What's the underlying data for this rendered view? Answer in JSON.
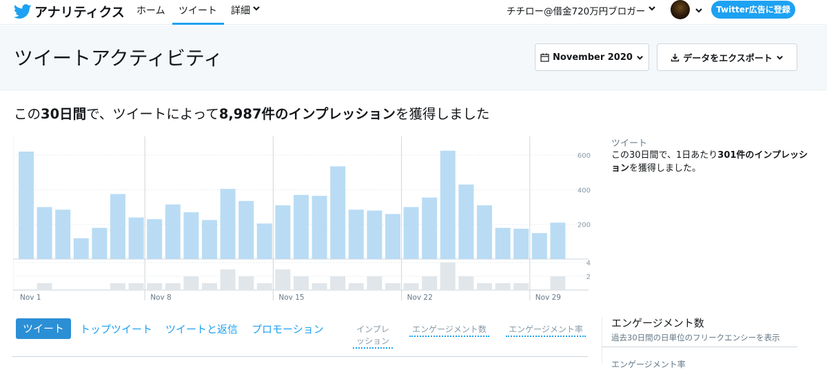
{
  "nav": {
    "brand": "アナリティクス",
    "links": [
      "ホーム",
      "ツイート",
      "詳細"
    ],
    "user": "チチロー@借金720万円ブロガー",
    "cta": "Twitter広告に登録"
  },
  "header": {
    "title": "ツイートアクティビティ",
    "date_button": "November 2020",
    "export_button": "データをエクスポート"
  },
  "summary": {
    "prefix": "この",
    "days": "30日間",
    "mid": "で、ツイートによって",
    "count": "8,987件のインプレッション",
    "suffix": "を獲得しました"
  },
  "side": {
    "label": "ツイート",
    "text_a": "この30日間で、1日あたり",
    "text_b": "301件のインプレッション",
    "text_c": "を獲得しました。"
  },
  "tabs": [
    "ツイート",
    "トップツイート",
    "ツイートと返信",
    "プロモーション"
  ],
  "metric_tabs": [
    "インプレッション",
    "エンゲージメント数",
    "エンゲージメント率"
  ],
  "engagement": {
    "title": "エンゲージメント数",
    "subtitle": "過去30日間の日単位のフリークエンシーを表示",
    "next": "エンゲージメント率"
  },
  "colors": {
    "accent": "#1da1f2",
    "bar_top": "#b9dcf4",
    "bar_bottom": "#e1e6ea"
  },
  "chart_data": {
    "type": "bar",
    "categories": [
      "Nov 1",
      "Nov 2",
      "Nov 3",
      "Nov 4",
      "Nov 5",
      "Nov 6",
      "Nov 7",
      "Nov 8",
      "Nov 9",
      "Nov 10",
      "Nov 11",
      "Nov 12",
      "Nov 13",
      "Nov 14",
      "Nov 15",
      "Nov 16",
      "Nov 17",
      "Nov 18",
      "Nov 19",
      "Nov 20",
      "Nov 21",
      "Nov 22",
      "Nov 23",
      "Nov 24",
      "Nov 25",
      "Nov 26",
      "Nov 27",
      "Nov 28",
      "Nov 29",
      "Nov 30"
    ],
    "x_tick_labels": [
      "Nov 1",
      "Nov 8",
      "Nov 15",
      "Nov 22",
      "Nov 29"
    ],
    "series": [
      {
        "values": [
          620,
          300,
          285,
          120,
          180,
          375,
          240,
          230,
          315,
          270,
          225,
          405,
          335,
          205,
          310,
          370,
          365,
          535,
          285,
          280,
          260,
          300,
          355,
          625,
          430,
          310,
          180,
          175,
          150,
          210
        ]
      },
      {
        "values": [
          0,
          1,
          0,
          0,
          0,
          1,
          1,
          1,
          1,
          2,
          1,
          3,
          2,
          1,
          3,
          2,
          1,
          2,
          1,
          2,
          1,
          1,
          2,
          4,
          2,
          1,
          1,
          1,
          0,
          2
        ]
      }
    ],
    "ylim_top": [
      0,
      620
    ],
    "yticks_top": [
      200,
      400,
      600
    ],
    "ylim_bottom": [
      0,
      4
    ],
    "yticks_bottom": [
      2,
      4
    ]
  }
}
